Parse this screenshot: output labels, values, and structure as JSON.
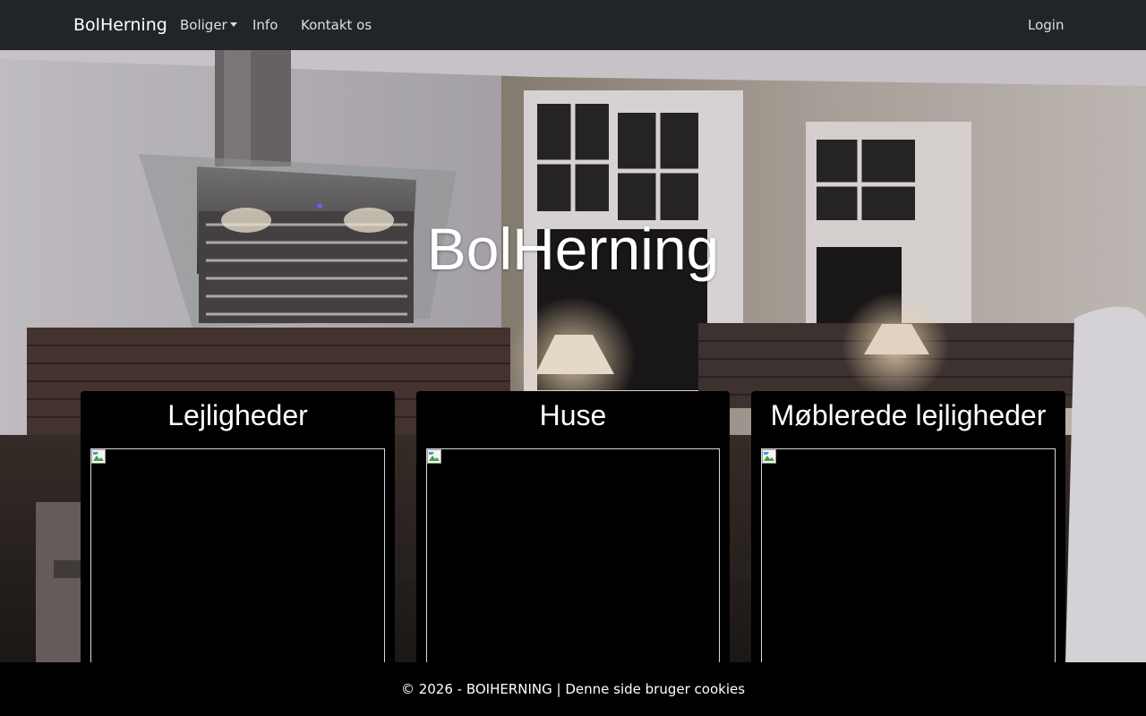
{
  "navbar": {
    "brand": "BolHerning",
    "items": [
      {
        "label": "Boliger"
      },
      {
        "label": "Info"
      },
      {
        "label": "Kontakt os"
      }
    ],
    "login_label": "Login"
  },
  "hero": {
    "title": "BolHerning"
  },
  "cards": [
    {
      "title": "Lejligheder"
    },
    {
      "title": "Huse"
    },
    {
      "title": "Møblerede lejligheder"
    }
  ],
  "footer": {
    "text": "© 2026 - BOIHERNING | Denne side bruger cookies"
  },
  "colors": {
    "navbar_bg": "#212529",
    "footer_bg": "#000000",
    "card_bg": "#000000"
  },
  "icons": {
    "dropdown": "caret-down-icon",
    "card_image": "broken-image-icon"
  }
}
